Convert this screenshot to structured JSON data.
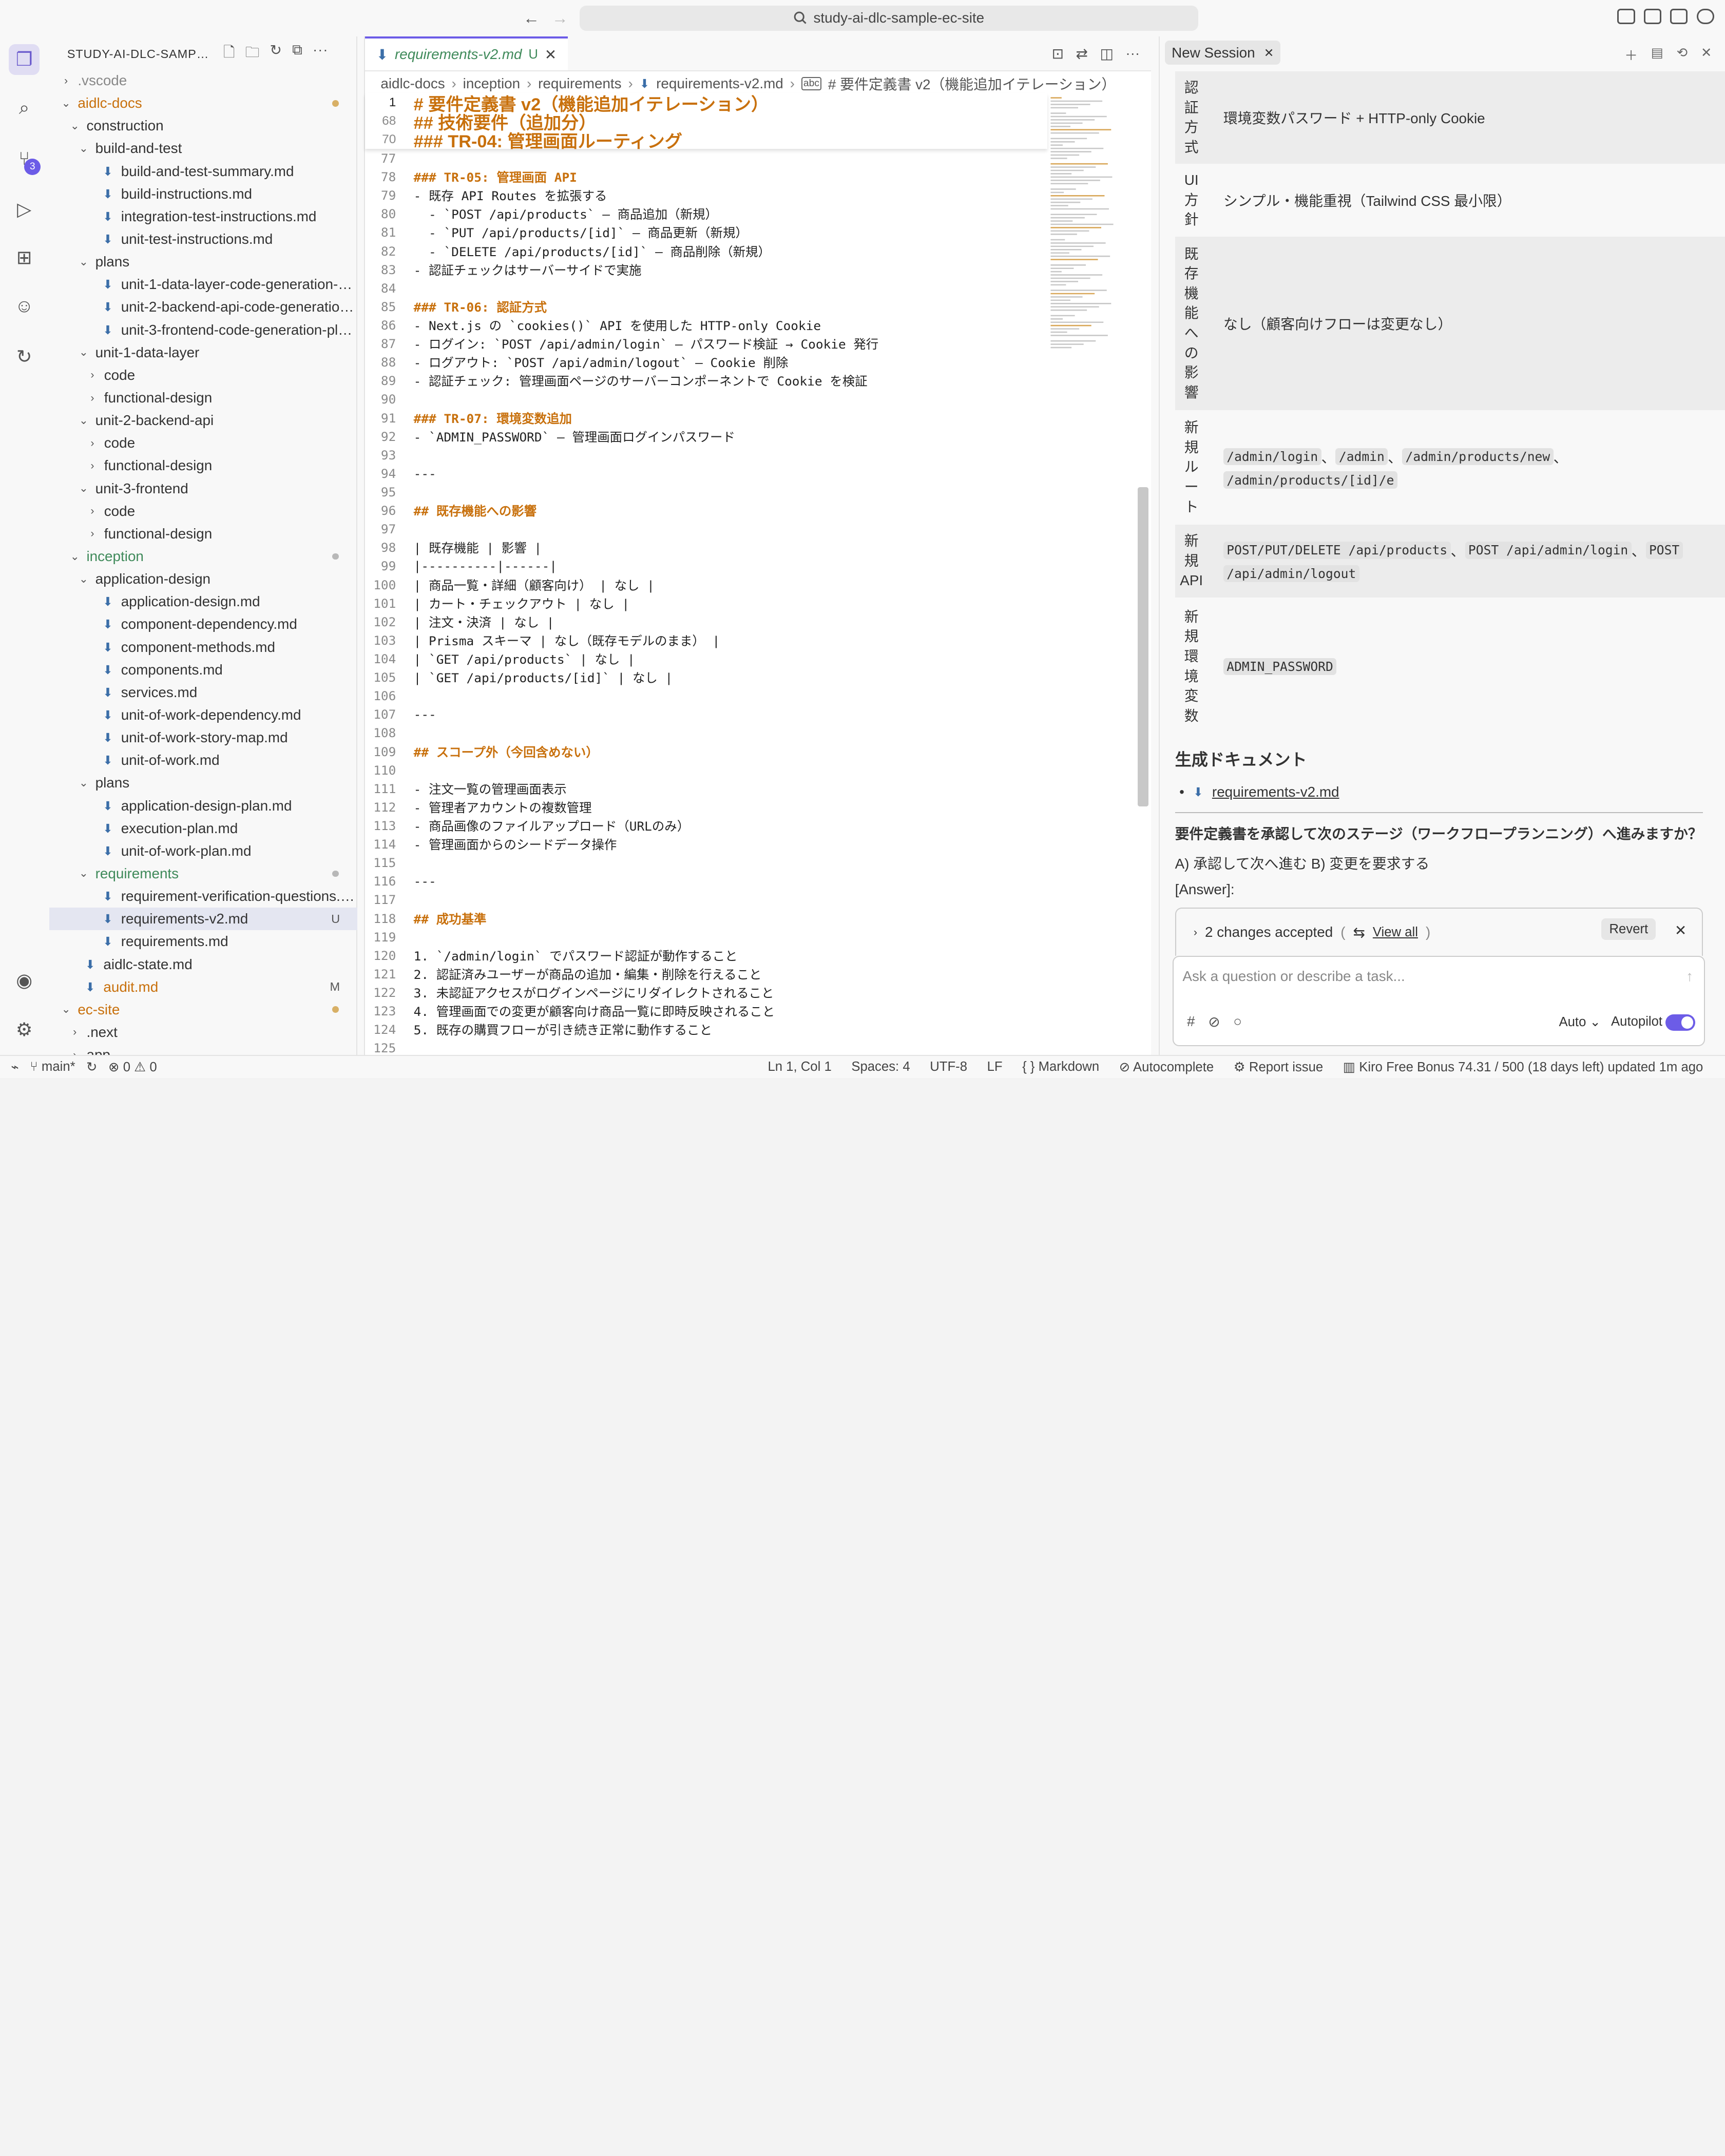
{
  "window": {
    "title": "study-ai-dlc-sample-ec-site"
  },
  "explorer": {
    "title": "STUDY-AI-DLC-SAMPLE...",
    "tree": [
      {
        "label": ".vscode",
        "depth": 1,
        "kind": "folder",
        "open": false,
        "color": "dim"
      },
      {
        "label": "aidlc-docs",
        "depth": 1,
        "kind": "folder",
        "open": true,
        "color": "orange",
        "dot": "#d8b066"
      },
      {
        "label": "construction",
        "depth": 2,
        "kind": "folder",
        "open": true
      },
      {
        "label": "build-and-test",
        "depth": 3,
        "kind": "folder",
        "open": true
      },
      {
        "label": "build-and-test-summary.md",
        "depth": 4,
        "kind": "file"
      },
      {
        "label": "build-instructions.md",
        "depth": 4,
        "kind": "file"
      },
      {
        "label": "integration-test-instructions.md",
        "depth": 4,
        "kind": "file"
      },
      {
        "label": "unit-test-instructions.md",
        "depth": 4,
        "kind": "file"
      },
      {
        "label": "plans",
        "depth": 3,
        "kind": "folder",
        "open": true
      },
      {
        "label": "unit-1-data-layer-code-generation-pla...",
        "depth": 4,
        "kind": "file"
      },
      {
        "label": "unit-2-backend-api-code-generation-...",
        "depth": 4,
        "kind": "file"
      },
      {
        "label": "unit-3-frontend-code-generation-plan...",
        "depth": 4,
        "kind": "file"
      },
      {
        "label": "unit-1-data-layer",
        "depth": 3,
        "kind": "folder",
        "open": true
      },
      {
        "label": "code",
        "depth": 4,
        "kind": "folder",
        "open": false
      },
      {
        "label": "functional-design",
        "depth": 4,
        "kind": "folder",
        "open": false
      },
      {
        "label": "unit-2-backend-api",
        "depth": 3,
        "kind": "folder",
        "open": true
      },
      {
        "label": "code",
        "depth": 4,
        "kind": "folder",
        "open": false
      },
      {
        "label": "functional-design",
        "depth": 4,
        "kind": "folder",
        "open": false
      },
      {
        "label": "unit-3-frontend",
        "depth": 3,
        "kind": "folder",
        "open": true
      },
      {
        "label": "code",
        "depth": 4,
        "kind": "folder",
        "open": false
      },
      {
        "label": "functional-design",
        "depth": 4,
        "kind": "folder",
        "open": false
      },
      {
        "label": "inception",
        "depth": 2,
        "kind": "folder",
        "open": true,
        "color": "green",
        "dot": "#b8b8b8"
      },
      {
        "label": "application-design",
        "depth": 3,
        "kind": "folder",
        "open": true
      },
      {
        "label": "application-design.md",
        "depth": 4,
        "kind": "file"
      },
      {
        "label": "component-dependency.md",
        "depth": 4,
        "kind": "file"
      },
      {
        "label": "component-methods.md",
        "depth": 4,
        "kind": "file"
      },
      {
        "label": "components.md",
        "depth": 4,
        "kind": "file"
      },
      {
        "label": "services.md",
        "depth": 4,
        "kind": "file"
      },
      {
        "label": "unit-of-work-dependency.md",
        "depth": 4,
        "kind": "file"
      },
      {
        "label": "unit-of-work-story-map.md",
        "depth": 4,
        "kind": "file"
      },
      {
        "label": "unit-of-work.md",
        "depth": 4,
        "kind": "file"
      },
      {
        "label": "plans",
        "depth": 3,
        "kind": "folder",
        "open": true
      },
      {
        "label": "application-design-plan.md",
        "depth": 4,
        "kind": "file"
      },
      {
        "label": "execution-plan.md",
        "depth": 4,
        "kind": "file"
      },
      {
        "label": "unit-of-work-plan.md",
        "depth": 4,
        "kind": "file"
      },
      {
        "label": "requirements",
        "depth": 3,
        "kind": "folder",
        "open": true,
        "color": "green",
        "dot": "#b8b8b8"
      },
      {
        "label": "requirement-verification-questions.md",
        "depth": 4,
        "kind": "file"
      },
      {
        "label": "requirements-v2.md",
        "depth": 4,
        "kind": "file",
        "status": "U",
        "selected": true
      },
      {
        "label": "requirements.md",
        "depth": 4,
        "kind": "file"
      },
      {
        "label": "aidlc-state.md",
        "depth": 2,
        "kind": "file"
      },
      {
        "label": "audit.md",
        "depth": 2,
        "kind": "file",
        "status": "M",
        "color": "orange"
      },
      {
        "label": "ec-site",
        "depth": 1,
        "kind": "folder",
        "open": true,
        "color": "orange",
        "dot": "#d8b066"
      },
      {
        "label": ".next",
        "depth": 2,
        "kind": "folder",
        "open": false
      },
      {
        "label": "app",
        "depth": 2,
        "kind": "folder",
        "open": false
      }
    ]
  },
  "editor": {
    "tab": {
      "label": "requirements-v2.md",
      "status": "U"
    },
    "breadcrumb": [
      "aidlc-docs",
      "inception",
      "requirements",
      "requirements-v2.md",
      "# 要件定義書 v2（機能追加イテレーション）"
    ],
    "sticky": [
      {
        "n": "1",
        "t": "# 要件定義書 v2（機能追加イテレーション）"
      },
      {
        "n": "68",
        "t": "## 技術要件（追加分）"
      },
      {
        "n": "70",
        "t": "### TR-04: 管理画面ルーティング"
      }
    ],
    "lines": [
      {
        "n": "77",
        "t": ""
      },
      {
        "n": "78",
        "t": "### TR-05: 管理画面 API"
      },
      {
        "n": "79",
        "t": "- 既存 API Routes を拡張する"
      },
      {
        "n": "80",
        "t": "  - `POST /api/products` — 商品追加（新規）"
      },
      {
        "n": "81",
        "t": "  - `PUT /api/products/[id]` — 商品更新（新規）"
      },
      {
        "n": "82",
        "t": "  - `DELETE /api/products/[id]` — 商品削除（新規）"
      },
      {
        "n": "83",
        "t": "- 認証チェックはサーバーサイドで実施"
      },
      {
        "n": "84",
        "t": ""
      },
      {
        "n": "85",
        "t": "### TR-06: 認証方式"
      },
      {
        "n": "86",
        "t": "- Next.js の `cookies()` API を使用した HTTP-only Cookie"
      },
      {
        "n": "87",
        "t": "- ログイン: `POST /api/admin/login` — パスワード検証 → Cookie 発行"
      },
      {
        "n": "88",
        "t": "- ログアウト: `POST /api/admin/logout` — Cookie 削除"
      },
      {
        "n": "89",
        "t": "- 認証チェック: 管理画面ページのサーバーコンポーネントで Cookie を検証"
      },
      {
        "n": "90",
        "t": ""
      },
      {
        "n": "91",
        "t": "### TR-07: 環境変数追加"
      },
      {
        "n": "92",
        "t": "- `ADMIN_PASSWORD` — 管理画面ログインパスワード"
      },
      {
        "n": "93",
        "t": ""
      },
      {
        "n": "94",
        "t": "---"
      },
      {
        "n": "95",
        "t": ""
      },
      {
        "n": "96",
        "t": "## 既存機能への影響"
      },
      {
        "n": "97",
        "t": ""
      },
      {
        "n": "98",
        "t": "| 既存機能 | 影響 |"
      },
      {
        "n": "99",
        "t": "|----------|------|"
      },
      {
        "n": "100",
        "t": "| 商品一覧・詳細（顧客向け） | なし |"
      },
      {
        "n": "101",
        "t": "| カート・チェックアウト | なし |"
      },
      {
        "n": "102",
        "t": "| 注文・決済 | なし |"
      },
      {
        "n": "103",
        "t": "| Prisma スキーマ | なし（既存モデルのまま） |"
      },
      {
        "n": "104",
        "t": "| `GET /api/products` | なし |"
      },
      {
        "n": "105",
        "t": "| `GET /api/products/[id]` | なし |"
      },
      {
        "n": "106",
        "t": ""
      },
      {
        "n": "107",
        "t": "---"
      },
      {
        "n": "108",
        "t": ""
      },
      {
        "n": "109",
        "t": "## スコープ外（今回含めない）"
      },
      {
        "n": "110",
        "t": ""
      },
      {
        "n": "111",
        "t": "- 注文一覧の管理画面表示"
      },
      {
        "n": "112",
        "t": "- 管理者アカウントの複数管理"
      },
      {
        "n": "113",
        "t": "- 商品画像のファイルアップロード（URLのみ）"
      },
      {
        "n": "114",
        "t": "- 管理画面からのシードデータ操作"
      },
      {
        "n": "115",
        "t": ""
      },
      {
        "n": "116",
        "t": "---"
      },
      {
        "n": "117",
        "t": ""
      },
      {
        "n": "118",
        "t": "## 成功基準"
      },
      {
        "n": "119",
        "t": ""
      },
      {
        "n": "120",
        "t": "1. `/admin/login` でパスワード認証が動作すること"
      },
      {
        "n": "121",
        "t": "2. 認証済みユーザーが商品の追加・編集・削除を行えること"
      },
      {
        "n": "122",
        "t": "3. 未認証アクセスがログインページにリダイレクトされること"
      },
      {
        "n": "123",
        "t": "4. 管理画面での変更が顧客向け商品一覧に即時反映されること"
      },
      {
        "n": "124",
        "t": "5. 既存の購買フローが引き続き正常に動作すること"
      },
      {
        "n": "125",
        "t": ""
      }
    ]
  },
  "chat": {
    "tab": "New Session",
    "table": [
      {
        "key": "認証方式",
        "value": "環境変数パスワード + HTTP-only Cookie",
        "codes": false,
        "h": 84
      },
      {
        "key": "UI方針",
        "value": "シンプル・機能重視（Tailwind CSS 最小限）",
        "codes": false,
        "h": 66
      },
      {
        "key": "既存機能への影響",
        "value": "なし（顧客向けフローは変更なし）",
        "codes": false,
        "h": 158
      },
      {
        "key": "新規ルート",
        "codes": true,
        "h": 104,
        "parts": [
          "/admin/login",
          "、",
          "/admin",
          "、",
          "/admin/products/new",
          "、",
          "/admin/products/[id]/e"
        ]
      },
      {
        "key": "新規API",
        "codes": true,
        "h": 66,
        "parts": [
          "POST/PUT/DELETE /api/products",
          "、",
          "POST /api/admin/login",
          "、",
          "POST",
          "/api/admin/logout"
        ]
      },
      {
        "key": "新規環境変数",
        "codes": true,
        "h": 126,
        "parts": [
          "ADMIN_PASSWORD"
        ]
      }
    ],
    "generated_docs_heading": "生成ドキュメント",
    "generated_doc": "requirements-v2.md",
    "question": "要件定義書を承認して次のステージ（ワークフロープランニング）へ進みますか？",
    "options": "A) 承認して次へ進む B) 変更を要求する",
    "answer_label": "[Answer]:",
    "changes": {
      "text": "2 changes accepted",
      "view_all": "View all",
      "revert": "Revert"
    },
    "input_placeholder": "Ask a question or describe a task...",
    "mode": "Auto",
    "autopilot": "Autopilot",
    "autopilot_on": true
  },
  "status": {
    "branch": "main*",
    "errors": "0",
    "warnings": "0",
    "position": "Ln 1, Col 1",
    "spaces": "Spaces: 4",
    "encoding": "UTF-8",
    "eol": "LF",
    "language": "Markdown",
    "autocomplete": "Autocomplete",
    "report": "Report issue",
    "plan": "Kiro Free Bonus 74.31 / 500 (18 days left) updated 1m ago"
  }
}
